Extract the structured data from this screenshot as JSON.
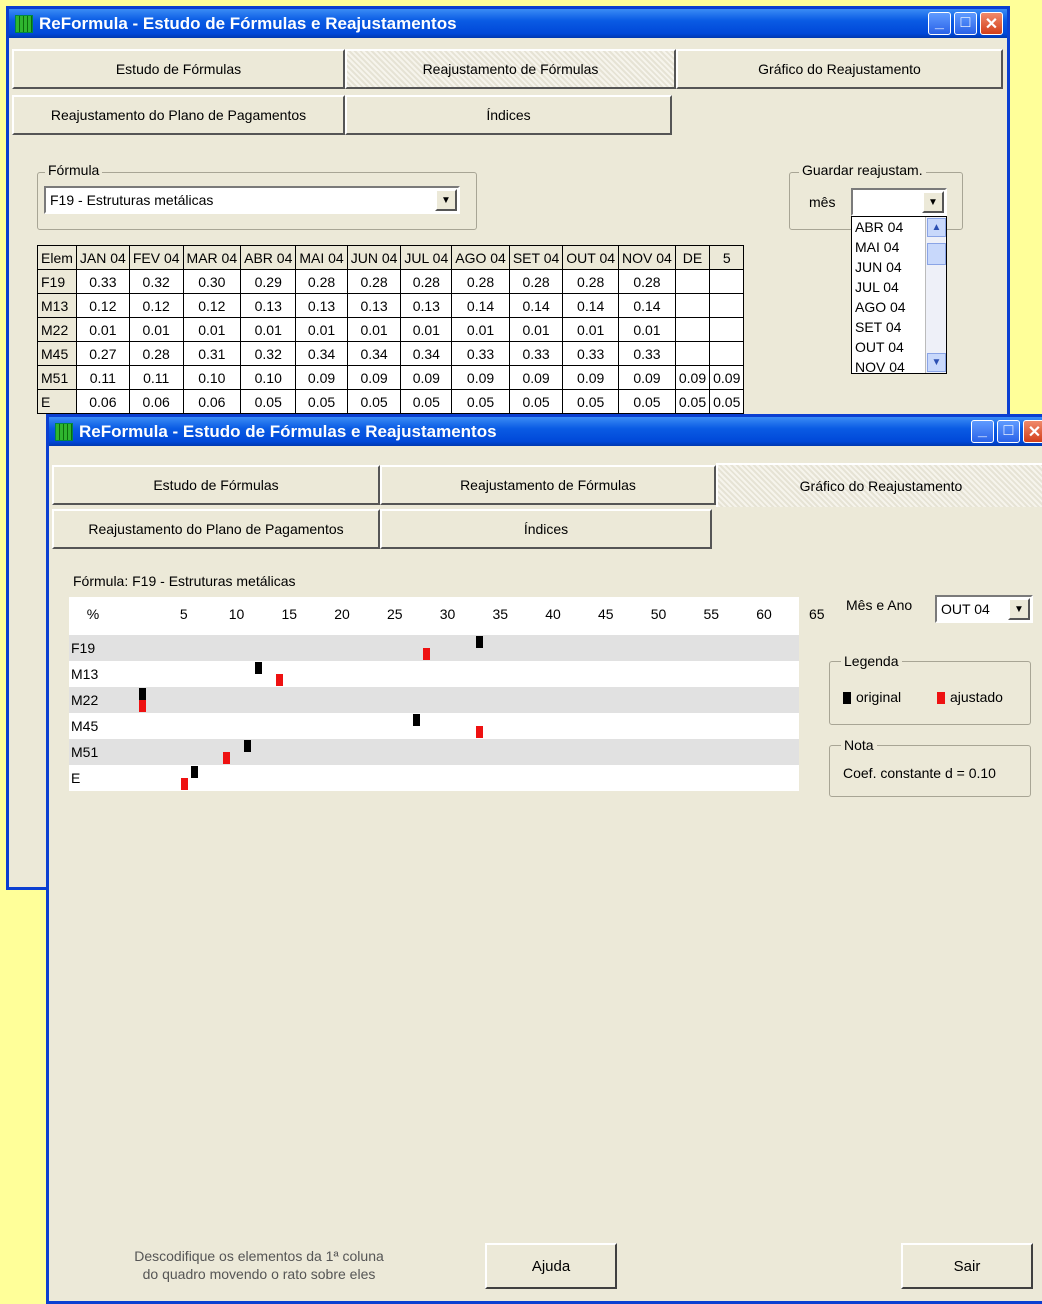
{
  "window_title": "ReFormula - Estudo de Fórmulas e Reajustamentos",
  "tabs": [
    "Estudo de Fórmulas",
    "Reajustamento de Fórmulas",
    "Gráfico do Reajustamento",
    "Reajustamento do Plano de Pagamentos",
    "Índices"
  ],
  "back_window": {
    "active_tab": "Reajustamento de Fórmulas",
    "formula_group_label": "Fórmula",
    "formula_value": "F19 - Estruturas metálicas",
    "guardar_group_label": "Guardar reajustam.",
    "mes_label": "mês",
    "mes_value": "",
    "dropdown_items": [
      "ABR 04",
      "MAI 04",
      "JUN 04",
      "JUL 04",
      "AGO 04",
      "SET 04",
      "OUT 04",
      "NOV 04"
    ],
    "table": {
      "corner": "Elem",
      "columns": [
        "JAN 04",
        "FEV 04",
        "MAR 04",
        "ABR 04",
        "MAI 04",
        "JUN 04",
        "JUL 04",
        "AGO 04",
        "SET 04",
        "OUT 04",
        "NOV 04",
        "DE",
        "5"
      ],
      "rows": [
        {
          "elem": "F19",
          "values": [
            "0.33",
            "0.32",
            "0.30",
            "0.29",
            "0.28",
            "0.28",
            "0.28",
            "0.28",
            "0.28",
            "0.28",
            "0.28",
            "",
            ""
          ]
        },
        {
          "elem": "M13",
          "values": [
            "0.12",
            "0.12",
            "0.12",
            "0.13",
            "0.13",
            "0.13",
            "0.13",
            "0.14",
            "0.14",
            "0.14",
            "0.14",
            "",
            ""
          ]
        },
        {
          "elem": "M22",
          "values": [
            "0.01",
            "0.01",
            "0.01",
            "0.01",
            "0.01",
            "0.01",
            "0.01",
            "0.01",
            "0.01",
            "0.01",
            "0.01",
            "",
            ""
          ]
        },
        {
          "elem": "M45",
          "values": [
            "0.27",
            "0.28",
            "0.31",
            "0.32",
            "0.34",
            "0.34",
            "0.34",
            "0.33",
            "0.33",
            "0.33",
            "0.33",
            "",
            ""
          ]
        },
        {
          "elem": "M51",
          "values": [
            "0.11",
            "0.11",
            "0.10",
            "0.10",
            "0.09",
            "0.09",
            "0.09",
            "0.09",
            "0.09",
            "0.09",
            "0.09",
            "0.09",
            "0.09"
          ]
        },
        {
          "elem": "E",
          "values": [
            "0.06",
            "0.06",
            "0.06",
            "0.05",
            "0.05",
            "0.05",
            "0.05",
            "0.05",
            "0.05",
            "0.05",
            "0.05",
            "0.05",
            "0.05"
          ]
        }
      ]
    }
  },
  "front_window": {
    "active_tab": "Gráfico do Reajustamento",
    "formula_caption": "Fórmula: F19 - Estruturas metálicas",
    "mes_ano_label": "Mês e Ano",
    "mes_ano_value": "OUT 04",
    "legenda_label": "Legenda",
    "legend_original": "original",
    "legend_ajustado": "ajustado",
    "nota_label": "Nota",
    "nota_text": "Coef. constante d = 0.10",
    "hint_line1": "Descodifique os elementos da 1ª coluna",
    "hint_line2": "do quadro movendo o rato sobre eles",
    "ajuda_label": "Ajuda",
    "sair_label": "Sair",
    "colors": {
      "original": "#000000",
      "ajustado": "#ee1111",
      "row_alt": "#e1e1e1"
    }
  },
  "chart_data": {
    "type": "scatter",
    "unit_label": "%",
    "x_ticks": [
      "5",
      "10",
      "15",
      "20",
      "25",
      "30",
      "35",
      "40",
      "45",
      "50",
      "55",
      "60",
      "65"
    ],
    "categories": [
      "F19",
      "M13",
      "M22",
      "M45",
      "M51",
      "E"
    ],
    "series": [
      {
        "name": "original",
        "values": [
          33,
          12,
          1,
          27,
          11,
          6
        ]
      },
      {
        "name": "ajustado",
        "values": [
          28,
          14,
          1,
          33,
          9,
          5
        ]
      }
    ],
    "xlim": [
      0,
      65
    ]
  }
}
